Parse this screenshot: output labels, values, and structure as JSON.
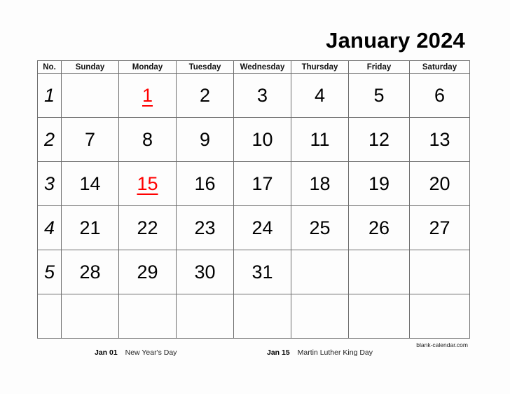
{
  "title": "January 2024",
  "headers": [
    "No.",
    "Sunday",
    "Monday",
    "Tuesday",
    "Wednesday",
    "Thursday",
    "Friday",
    "Saturday"
  ],
  "weeks": [
    {
      "no": "1",
      "days": [
        "",
        "1",
        "2",
        "3",
        "4",
        "5",
        "6"
      ]
    },
    {
      "no": "2",
      "days": [
        "7",
        "8",
        "9",
        "10",
        "11",
        "12",
        "13"
      ]
    },
    {
      "no": "3",
      "days": [
        "14",
        "15",
        "16",
        "17",
        "18",
        "19",
        "20"
      ]
    },
    {
      "no": "4",
      "days": [
        "21",
        "22",
        "23",
        "24",
        "25",
        "26",
        "27"
      ]
    },
    {
      "no": "5",
      "days": [
        "28",
        "29",
        "30",
        "31",
        "",
        "",
        ""
      ]
    },
    {
      "no": "",
      "days": [
        "",
        "",
        "",
        "",
        "",
        "",
        ""
      ]
    }
  ],
  "holiday_days": [
    "1",
    "15"
  ],
  "holiday_color": "#ff0000",
  "holidays": [
    {
      "date": "Jan 01",
      "name": "New Year's Day"
    },
    {
      "date": "Jan 15",
      "name": "Martin Luther King Day"
    }
  ],
  "credit": "blank-calendar.com"
}
